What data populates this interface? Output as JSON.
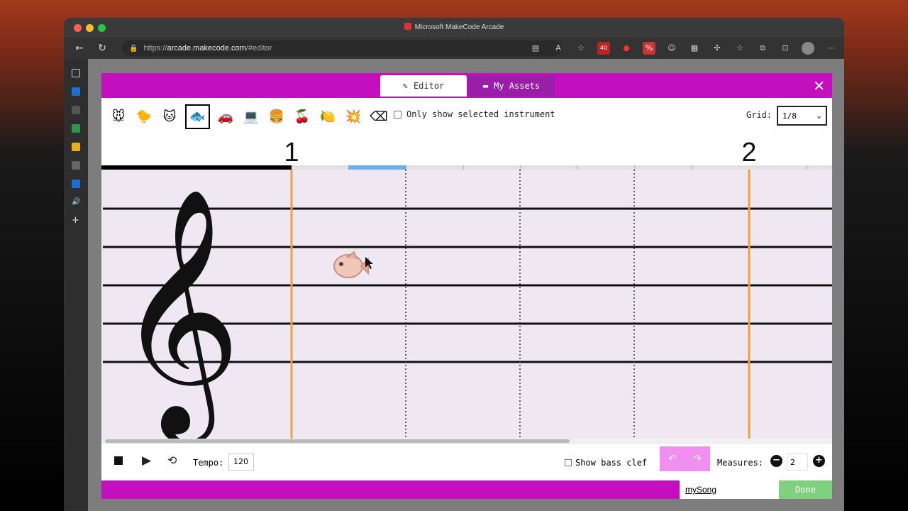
{
  "window": {
    "title": "Microsoft MakeCode Arcade"
  },
  "browser": {
    "url_prefix": "https://",
    "url_host": "arcade.makecode.com",
    "url_path": "/#editor",
    "ext_badge": "40"
  },
  "dialog": {
    "tabs": [
      {
        "label": "Editor",
        "icon": "paintbrush-icon",
        "selected": true
      },
      {
        "label": "My Assets",
        "icon": "folder-icon",
        "selected": false
      }
    ],
    "instruments": [
      {
        "name": "dog-icon",
        "glyph": "🐭"
      },
      {
        "name": "duck-icon",
        "glyph": "🐤"
      },
      {
        "name": "cat-icon",
        "glyph": "🐱"
      },
      {
        "name": "fish-icon",
        "glyph": "🐟"
      },
      {
        "name": "car-icon",
        "glyph": "🚗"
      },
      {
        "name": "computer-icon",
        "glyph": "💻"
      },
      {
        "name": "burger-icon",
        "glyph": "🍔"
      },
      {
        "name": "cherry-icon",
        "glyph": "🍒"
      },
      {
        "name": "lemon-icon",
        "glyph": "🍋"
      },
      {
        "name": "explosion-icon",
        "glyph": "💥"
      },
      {
        "name": "eraser-icon",
        "glyph": "⌫"
      }
    ],
    "selected_instrument_index": 3,
    "only_show_label": "Only show selected instrument",
    "grid_label": "Grid:",
    "grid_value": "1/8",
    "measure_numbers": [
      "1",
      "2"
    ],
    "tempo_label": "Tempo:",
    "tempo_value": "120",
    "bass_clef_label": "Show bass clef",
    "measures_label": "Measures:",
    "measures_value": "2",
    "song_name": "mySong",
    "done_label": "Done"
  },
  "colors": {
    "accent": "#c40fbf",
    "assets_tab": "#9a1ea8",
    "staff_bg": "#efe8f2",
    "measure_line": "#f0a040",
    "playhead": "#6ab0f0",
    "done": "#7fd07f"
  }
}
